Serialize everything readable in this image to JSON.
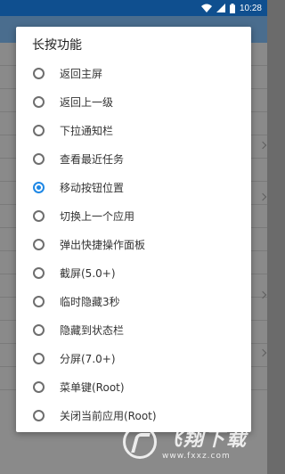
{
  "status_bar": {
    "time": "10:28",
    "icons": [
      "wifi-icon",
      "signal-icon",
      "battery-icon"
    ]
  },
  "dialog": {
    "title": "长按功能",
    "options": [
      {
        "label": "返回主屏",
        "checked": false
      },
      {
        "label": "返回上一级",
        "checked": false
      },
      {
        "label": "下拉通知栏",
        "checked": false
      },
      {
        "label": "查看最近任务",
        "checked": false
      },
      {
        "label": "移动按钮位置",
        "checked": true
      },
      {
        "label": "切换上一个应用",
        "checked": false
      },
      {
        "label": "弹出快捷操作面板",
        "checked": false
      },
      {
        "label": "截屏(5.0+)",
        "checked": false
      },
      {
        "label": "临时隐藏3秒",
        "checked": false
      },
      {
        "label": "隐藏到状态栏",
        "checked": false
      },
      {
        "label": "分屏(7.0+)",
        "checked": false
      },
      {
        "label": "菜单键(Root)",
        "checked": false
      },
      {
        "label": "关闭当前应用(Root)",
        "checked": false
      }
    ]
  },
  "watermark": {
    "title": "飞翔下载",
    "url": "www.fxxz.com"
  },
  "colors": {
    "accent": "#1f88e5",
    "status_bar": "#0f4f8f"
  }
}
